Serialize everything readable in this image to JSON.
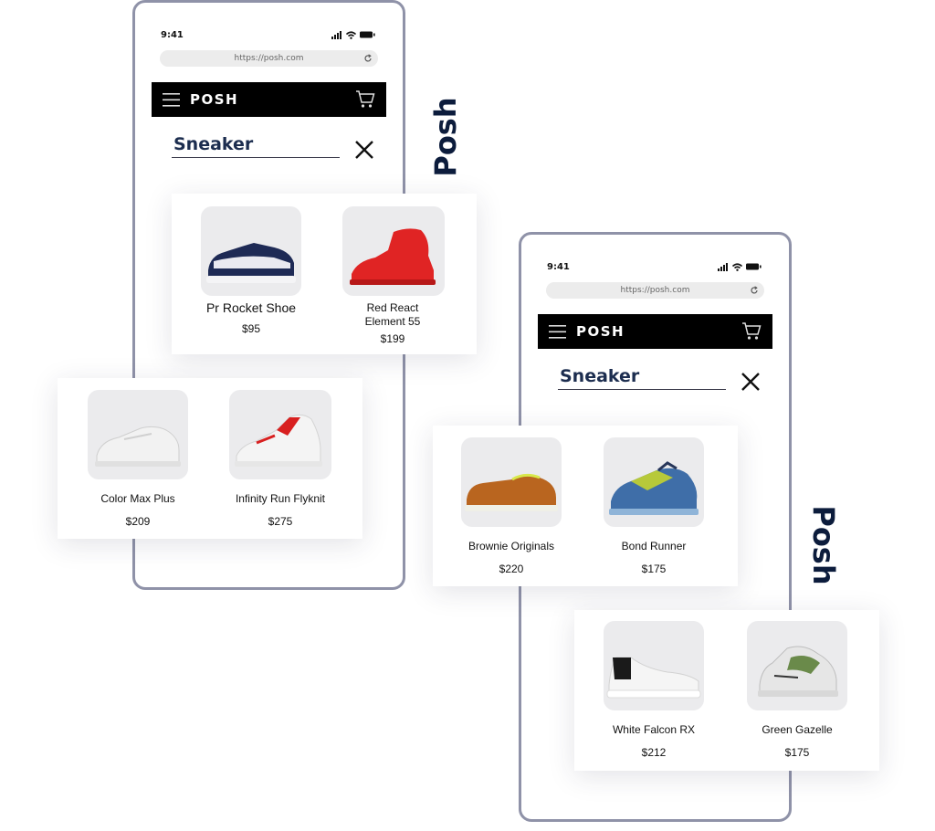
{
  "colors": {
    "frame": "#8f92a8",
    "nav": "#000000",
    "brand_text": "#0c1c3c",
    "search_text": "#1c2d4f"
  },
  "side_brand": "Posh",
  "phones": [
    {
      "status_time": "9:41",
      "url": "https://posh.com",
      "logo": "POSH",
      "search_value": "Sneaker",
      "icons": [
        "signal-icon",
        "wifi-icon",
        "battery-icon",
        "reload-icon",
        "hamburger-menu-icon",
        "cart-icon",
        "close-icon"
      ]
    },
    {
      "status_time": "9:41",
      "url": "https://posh.com",
      "logo": "POSH",
      "search_value": "Sneaker",
      "icons": [
        "signal-icon",
        "wifi-icon",
        "battery-icon",
        "reload-icon",
        "hamburger-menu-icon",
        "cart-icon",
        "close-icon"
      ]
    }
  ],
  "cards": [
    {
      "products": [
        {
          "name": "Pr Rocket Shoe",
          "price": "$95"
        },
        {
          "name": "Red React Element 55",
          "price": "$199"
        }
      ]
    },
    {
      "products": [
        {
          "name": "Color Max Plus",
          "price": "$209"
        },
        {
          "name": "Infinity Run Flyknit",
          "price": "$275"
        }
      ]
    },
    {
      "products": [
        {
          "name": "Brownie Originals",
          "price": "$220"
        },
        {
          "name": "Bond Runner",
          "price": "$175"
        }
      ]
    },
    {
      "products": [
        {
          "name": "White Falcon RX",
          "price": "$212"
        },
        {
          "name": "Green Gazelle",
          "price": "$175"
        }
      ]
    }
  ]
}
